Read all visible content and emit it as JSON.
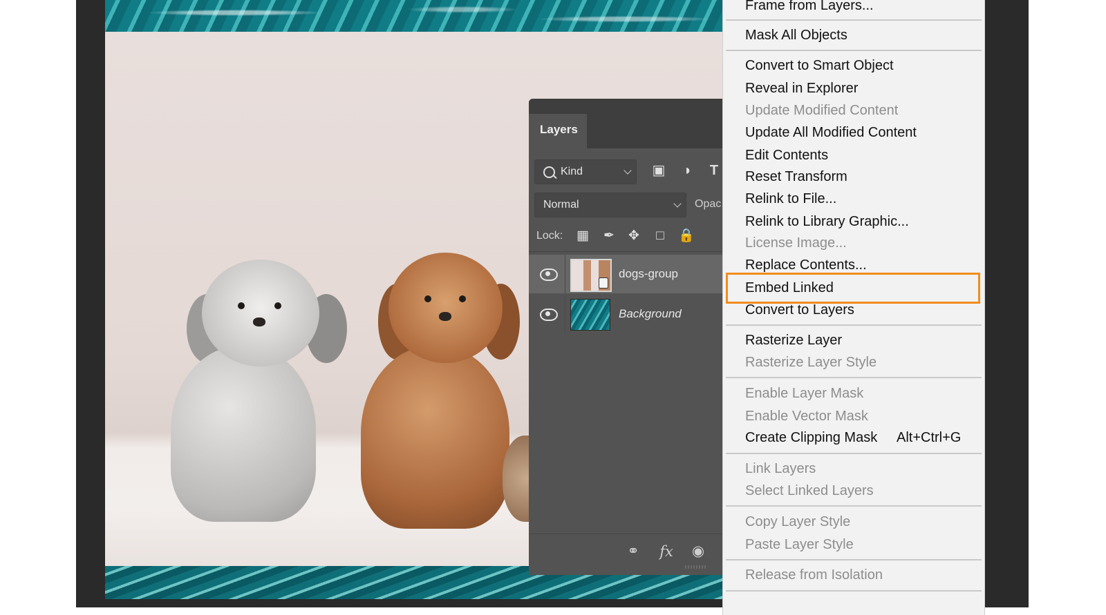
{
  "layers_panel": {
    "tab_label": "Layers",
    "filter_kind": "Kind",
    "blend_mode": "Normal",
    "opacity_label": "Opac",
    "lock_label": "Lock:",
    "filter_icons": [
      "image-filter-icon",
      "adjustment-filter-icon",
      "type-filter-icon"
    ],
    "lock_icons": [
      "lock-transparent-pixels-icon",
      "lock-image-pixels-icon",
      "lock-position-icon",
      "lock-artboard-icon",
      "lock-all-icon"
    ],
    "layers": [
      {
        "name": "dogs-group",
        "visible": true,
        "selected": true,
        "smart_object": true
      },
      {
        "name": "Background",
        "visible": true,
        "selected": false
      }
    ],
    "footer_icons": [
      "link-layers-icon",
      "fx-icon",
      "add-mask-icon"
    ],
    "fx_label": "fx"
  },
  "context_menu": {
    "items": [
      {
        "label": "Frame from Layers...",
        "enabled": true
      },
      {
        "label": "Mask All Objects",
        "enabled": true
      },
      {
        "label": "Convert to Smart Object",
        "enabled": true
      },
      {
        "label": "Reveal in Explorer",
        "enabled": true
      },
      {
        "label": "Update Modified Content",
        "enabled": false
      },
      {
        "label": "Update All Modified Content",
        "enabled": true
      },
      {
        "label": "Edit Contents",
        "enabled": true
      },
      {
        "label": "Reset Transform",
        "enabled": true
      },
      {
        "label": "Relink to File...",
        "enabled": true
      },
      {
        "label": "Relink to Library Graphic...",
        "enabled": true
      },
      {
        "label": "License Image...",
        "enabled": false
      },
      {
        "label": "Replace Contents...",
        "enabled": true
      },
      {
        "label": "Embed Linked",
        "enabled": true,
        "highlighted": true
      },
      {
        "label": "Convert to Layers",
        "enabled": true
      },
      {
        "label": "Rasterize Layer",
        "enabled": true
      },
      {
        "label": "Rasterize Layer Style",
        "enabled": false
      },
      {
        "label": "Enable Layer Mask",
        "enabled": false
      },
      {
        "label": "Enable Vector Mask",
        "enabled": false
      },
      {
        "label": "Create Clipping Mask",
        "enabled": true,
        "shortcut": "Alt+Ctrl+G"
      },
      {
        "label": "Link Layers",
        "enabled": false
      },
      {
        "label": "Select Linked Layers",
        "enabled": false
      },
      {
        "label": "Copy Layer Style",
        "enabled": false
      },
      {
        "label": "Paste Layer Style",
        "enabled": false
      },
      {
        "label": "Release from Isolation",
        "enabled": false
      }
    ],
    "highlight_color": "#f28c1c"
  }
}
